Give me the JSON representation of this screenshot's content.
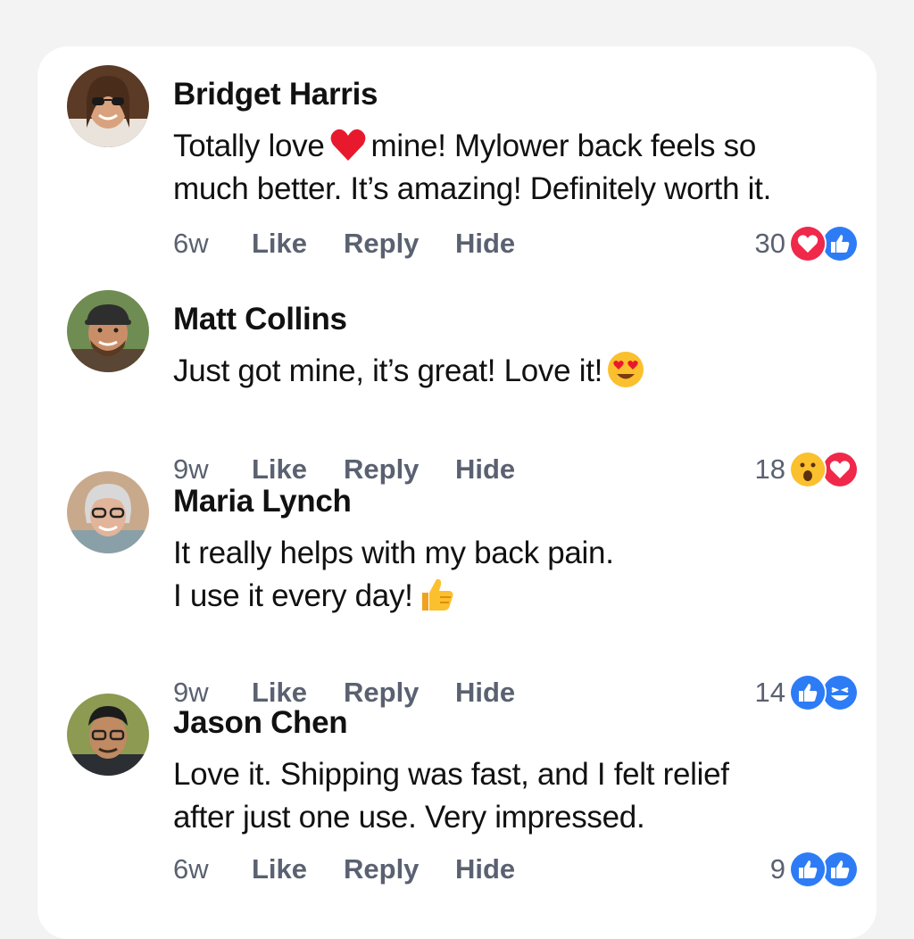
{
  "comments": [
    {
      "name": "Bridget Harris",
      "line1_a": "Totally love",
      "line1_b": "mine! Mylower back feels so",
      "line2": "much better. It’s amazing! Definitely worth it.",
      "time": "6w",
      "like": "Like",
      "reply": "Hide",
      "reply_label": "Reply",
      "count": "30",
      "reactions": [
        "love-reaction-icon",
        "like-reaction-icon"
      ]
    },
    {
      "name": "Matt Collins",
      "line1": "Just got mine, it’s great! Love it!",
      "time": "9w",
      "like": "Like",
      "reply_label": "Reply",
      "hide": "Hide",
      "count": "18",
      "reactions": [
        "wow-reaction-icon",
        "love-reaction-icon"
      ]
    },
    {
      "name": "Maria Lynch",
      "line1": "It really helps with my back pain.",
      "line2": "I use it every day!",
      "time": "9w",
      "like": "Like",
      "reply_label": "Reply",
      "hide": "Hide",
      "count": "14",
      "reactions": [
        "like-reaction-icon",
        "haha-reaction-icon"
      ]
    },
    {
      "name": "Jason Chen",
      "line1": "Love it. Shipping was fast, and I felt relief",
      "line2": "after just one use. Very impressed.",
      "time": "6w",
      "like": "Like",
      "reply_label": "Reply",
      "hide": "Hide",
      "count": "9",
      "reactions": [
        "like-reaction-icon",
        "like-reaction-icon"
      ]
    }
  ],
  "colors": {
    "like_blue": "#2d7cf6",
    "love_red": "#f0284a",
    "meta_gray": "#5a6170"
  }
}
